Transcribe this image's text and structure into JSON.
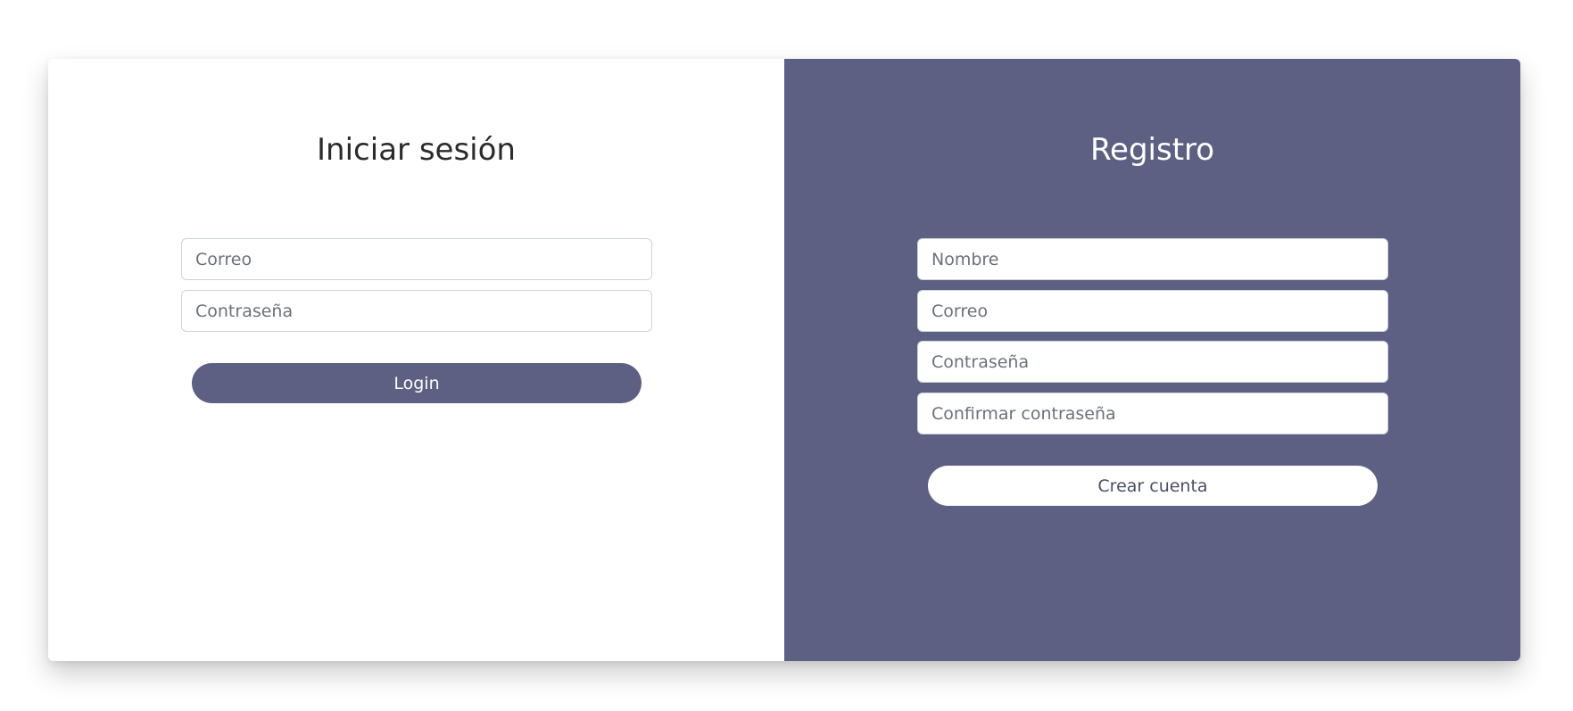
{
  "colors": {
    "accent": "#5d6083",
    "card_background": "#ffffff"
  },
  "login": {
    "title": "Iniciar sesión",
    "email_placeholder": "Correo",
    "password_placeholder": "Contraseña",
    "submit_label": "Login"
  },
  "register": {
    "title": "Registro",
    "name_placeholder": "Nombre",
    "email_placeholder": "Correo",
    "password_placeholder": "Contraseña",
    "confirm_password_placeholder": "Confirmar contraseña",
    "submit_label": "Crear cuenta"
  }
}
